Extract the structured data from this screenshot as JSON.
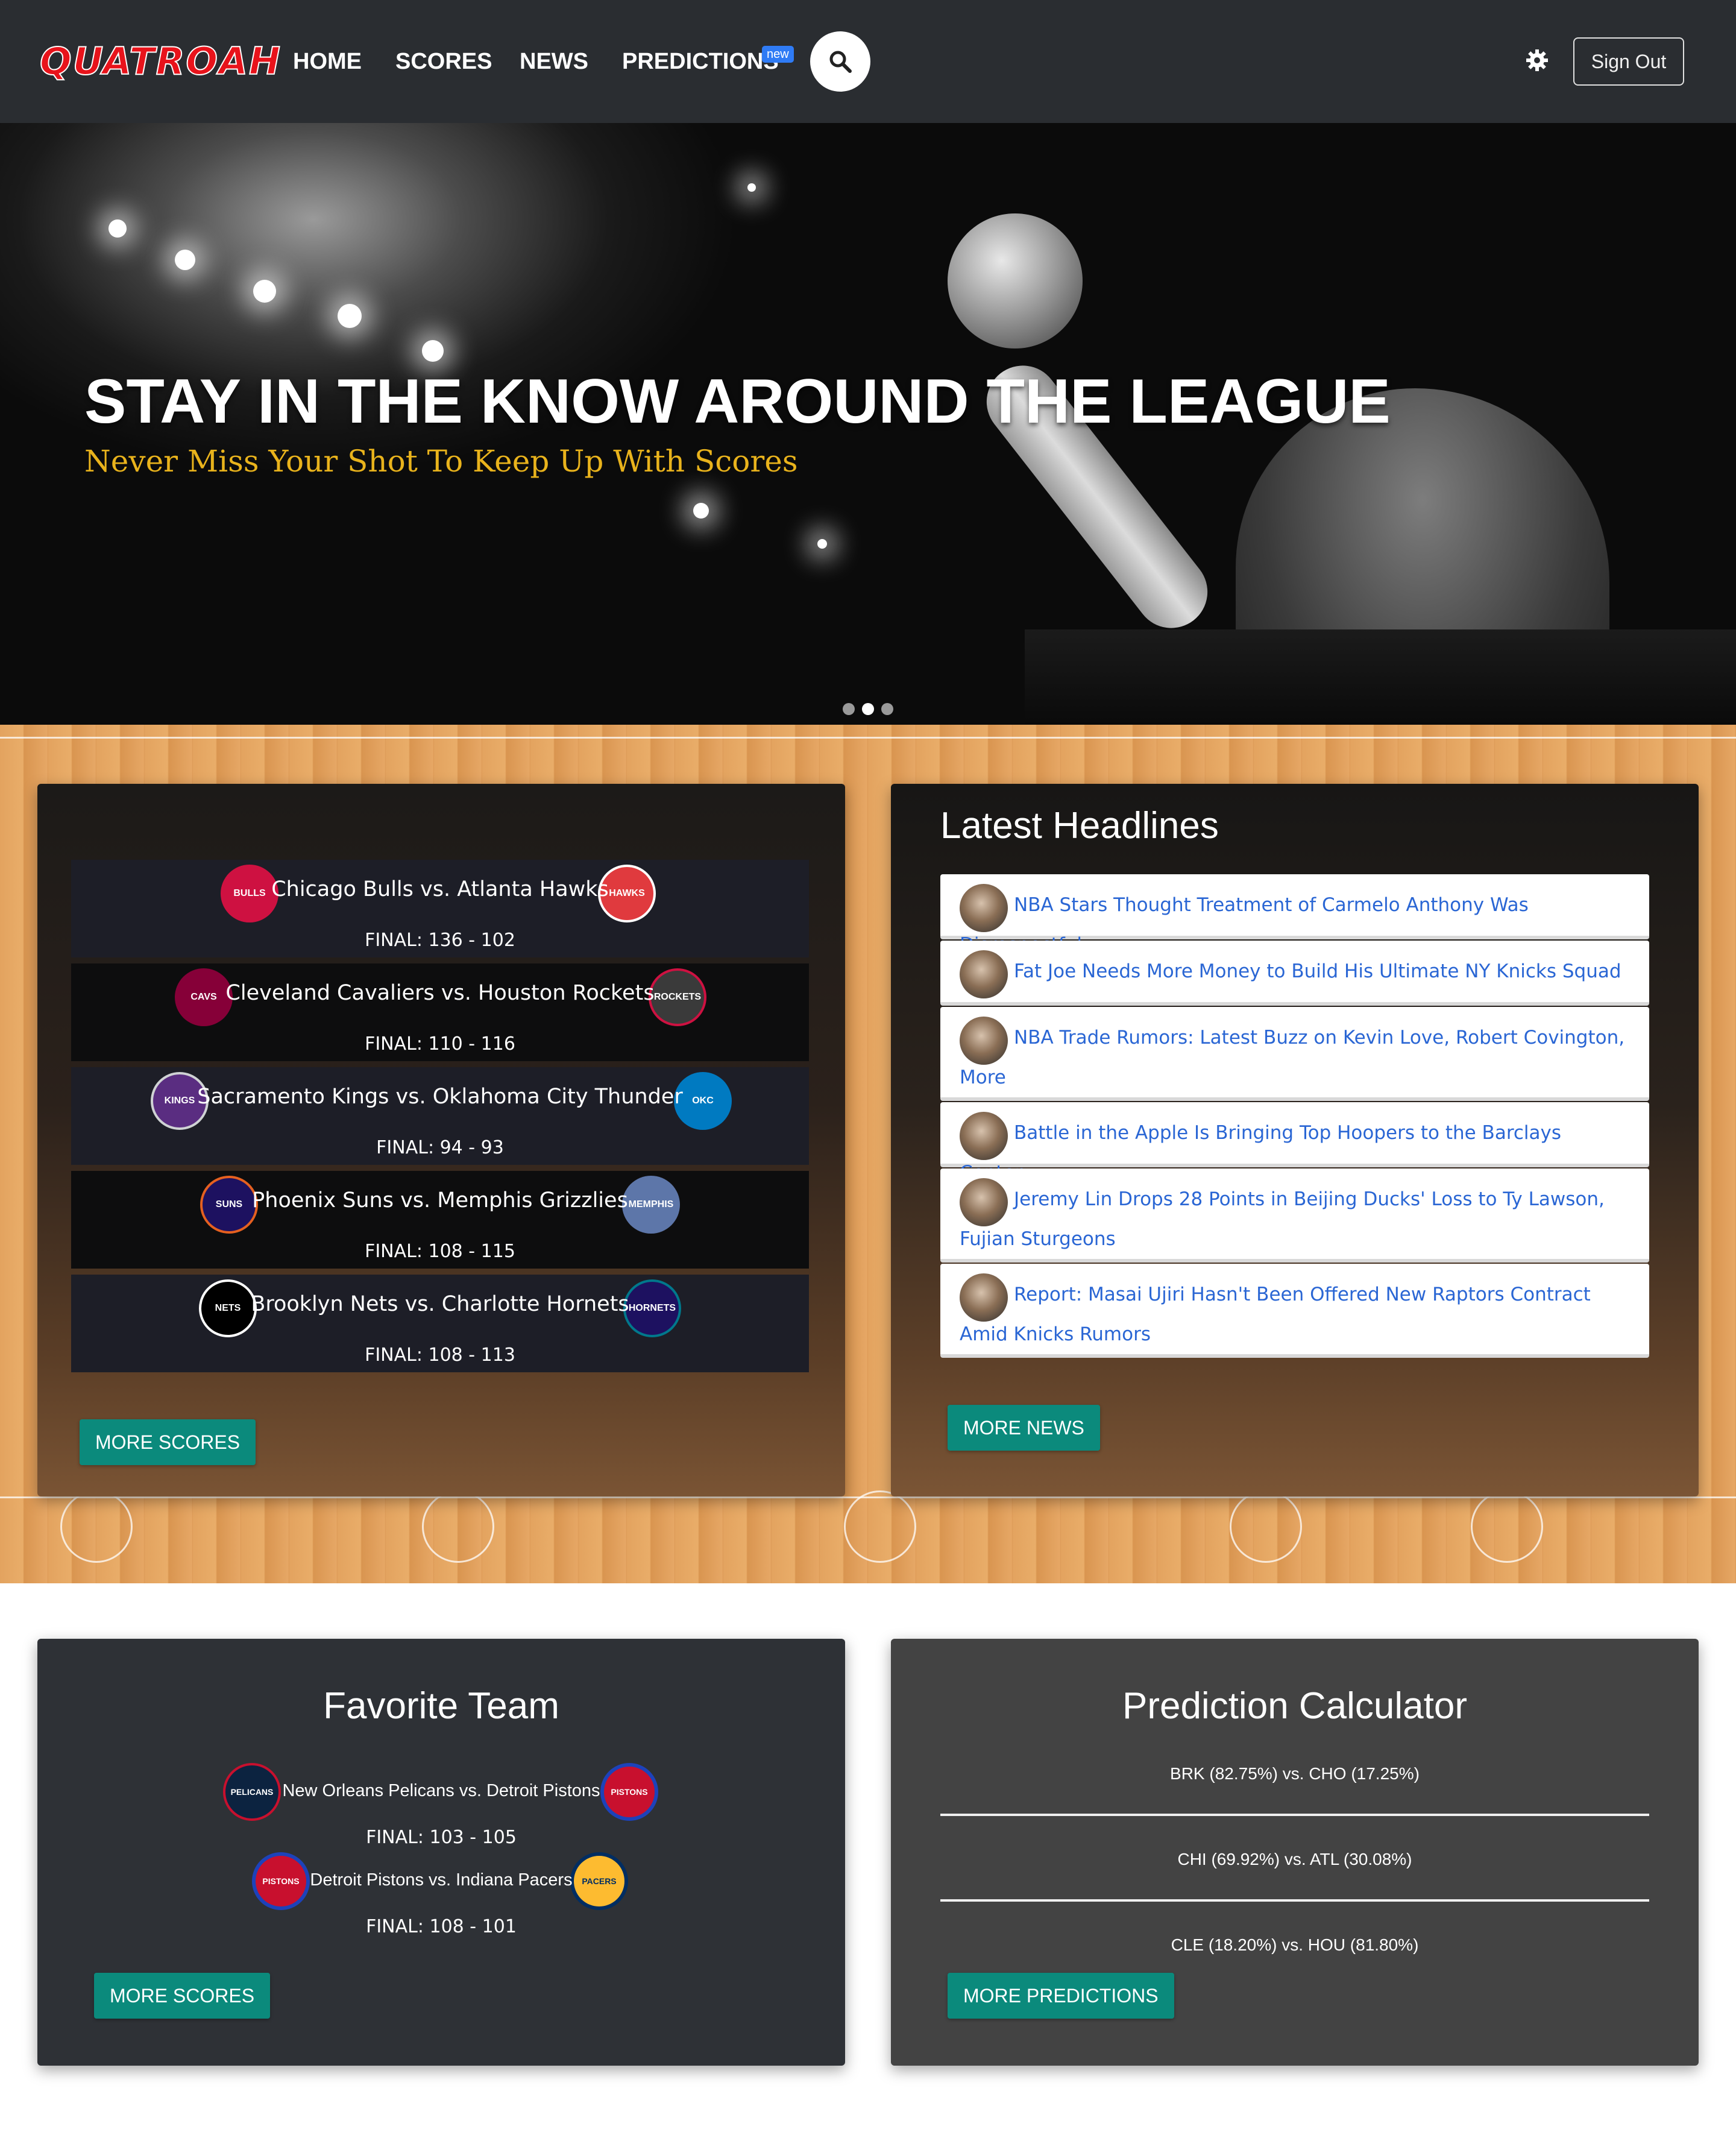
{
  "navbar": {
    "logo": "QUATROAH",
    "links": [
      "HOME",
      "SCORES",
      "NEWS",
      "PREDICTIONS"
    ],
    "predictions_badge": "new",
    "sign_out": "Sign Out",
    "icons": {
      "search": "search-icon",
      "settings": "gear-icon"
    }
  },
  "hero": {
    "title": "STAY IN THE KNOW AROUND THE LEAGUE",
    "subtitle": "Never Miss Your Shot To Keep Up With Scores",
    "active_slide": 2,
    "slide_count": 3
  },
  "scores": {
    "games": [
      {
        "title": "Chicago Bulls vs. Atlanta Hawks",
        "score": "FINAL: 136 - 102",
        "home_color": "#ce1141",
        "away_color": "#e03a3e"
      },
      {
        "title": "Cleveland Cavaliers vs. Houston Rockets",
        "score": "FINAL: 110 - 116",
        "home_color": "#860038",
        "away_color": "#ce1141"
      },
      {
        "title": "Sacramento Kings vs. Oklahoma City Thunder",
        "score": "FINAL: 94 - 93",
        "home_color": "#5a2d81",
        "away_color": "#007ac1"
      },
      {
        "title": "Phoenix Suns vs. Memphis Grizzlies",
        "score": "FINAL: 108 - 115",
        "home_color": "#e56020",
        "away_color": "#5d76a9"
      },
      {
        "title": "Brooklyn Nets vs. Charlotte Hornets",
        "score": "FINAL: 108 - 113",
        "home_color": "#000000",
        "away_color": "#1d1160"
      }
    ],
    "more_button": "MORE SCORES"
  },
  "news": {
    "title": "Latest Headlines",
    "items": [
      "NBA Stars Thought Treatment of Carmelo Anthony Was Disrespectful",
      "Fat Joe Needs More Money to Build His Ultimate NY Knicks Squad",
      "NBA Trade Rumors: Latest Buzz on Kevin Love, Robert Covington, More",
      "Battle in the Apple Is Bringing Top Hoopers to the Barclays Center",
      "Jeremy Lin Drops 28 Points in Beijing Ducks' Loss to Ty Lawson, Fujian Sturgeons",
      "Report: Masai Ujiri Hasn't Been Offered New Raptors Contract Amid Knicks Rumors"
    ],
    "more_button": "MORE NEWS"
  },
  "favorite": {
    "title": "Favorite Team",
    "games": [
      {
        "title": "New Orleans Pelicans vs. Detroit Pistons",
        "score": "FINAL: 103 - 105"
      },
      {
        "title": "Detroit Pistons vs. Indiana Pacers",
        "score": "FINAL: 108 - 101"
      }
    ],
    "more_button": "MORE SCORES"
  },
  "predictions": {
    "title": "Prediction Calculator",
    "lines": [
      "BRK (82.75%) vs. CHO (17.25%)",
      "CHI (69.92%) vs. ATL (30.08%)",
      "CLE (18.20%) vs. HOU (81.80%)"
    ],
    "more_button": "MORE PREDICTIONS"
  },
  "colors": {
    "navbar_bg": "#2a2d31",
    "accent_teal": "#0b8a7c",
    "hero_subtitle": "#e9b31c",
    "logo_red": "#e8131b",
    "news_link": "#2a66d4"
  }
}
